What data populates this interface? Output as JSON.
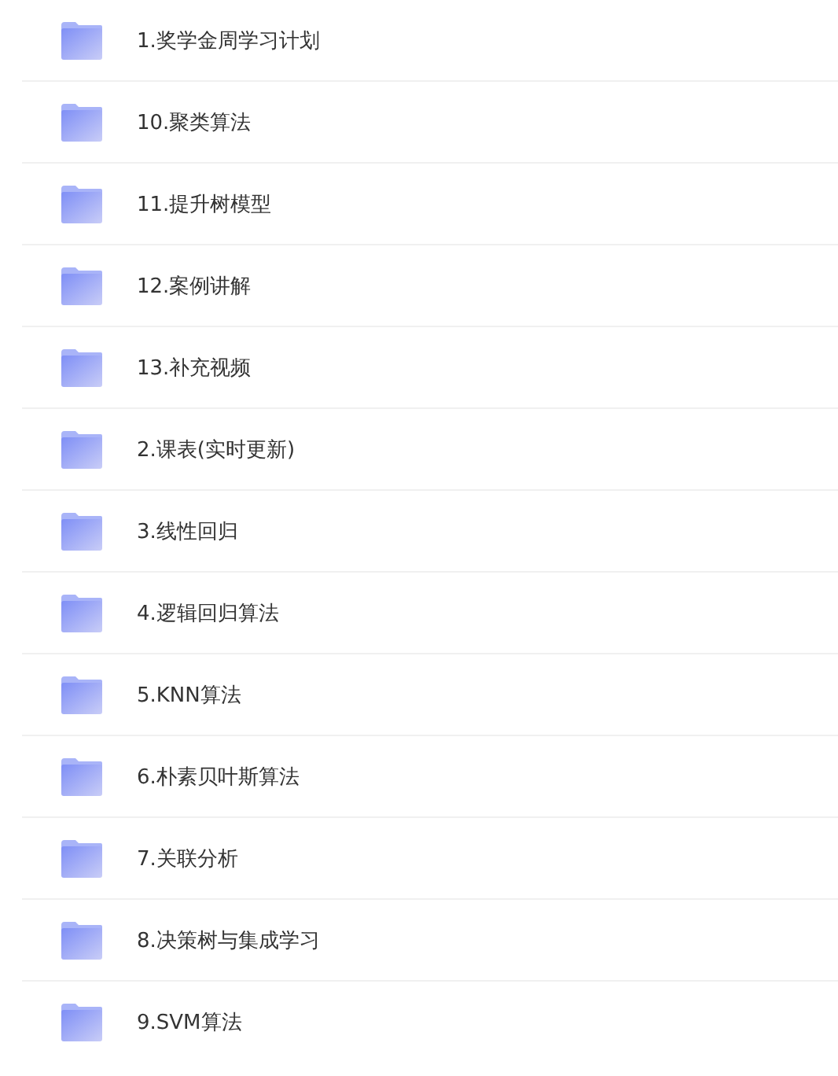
{
  "folders": [
    {
      "name": "1.奖学金周学习计划"
    },
    {
      "name": "10.聚类算法"
    },
    {
      "name": "11.提升树模型"
    },
    {
      "name": "12.案例讲解"
    },
    {
      "name": "13.补充视频"
    },
    {
      "name": "2.课表(实时更新)"
    },
    {
      "name": "3.线性回归"
    },
    {
      "name": "4.逻辑回归算法"
    },
    {
      "name": "5.KNN算法"
    },
    {
      "name": "6.朴素贝叶斯算法"
    },
    {
      "name": "7.关联分析"
    },
    {
      "name": "8.决策树与集成学习"
    },
    {
      "name": "9.SVM算法"
    }
  ]
}
